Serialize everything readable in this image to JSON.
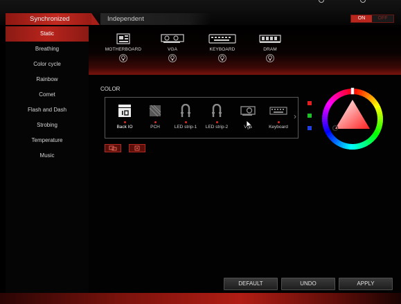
{
  "tabs": {
    "synchronized": "Synchronized",
    "independent": "Independent"
  },
  "toggle": {
    "on": "ON",
    "off": "OFF"
  },
  "sidebar": {
    "items": [
      {
        "label": "Static",
        "active": true
      },
      {
        "label": "Breathing"
      },
      {
        "label": "Color cycle"
      },
      {
        "label": "Rainbow"
      },
      {
        "label": "Comet"
      },
      {
        "label": "Flash and Dash"
      },
      {
        "label": "Strobing"
      },
      {
        "label": "Temperature"
      },
      {
        "label": "Music"
      }
    ]
  },
  "devices": [
    {
      "label": "MOTHERBOARD",
      "icon": "motherboard-icon"
    },
    {
      "label": "VGA",
      "icon": "vga-icon"
    },
    {
      "label": "KEYBOARD",
      "icon": "keyboard-icon"
    },
    {
      "label": "DRAM",
      "icon": "dram-icon"
    }
  ],
  "color_section": {
    "title": "COLOR"
  },
  "zones": [
    {
      "label": "Back IO",
      "icon": "back-io-icon"
    },
    {
      "label": "PCH",
      "icon": "pch-icon"
    },
    {
      "label": "LED strip-1",
      "icon": "led-strip-icon"
    },
    {
      "label": "LED strip-2",
      "icon": "led-strip-icon"
    },
    {
      "label": "Vga",
      "icon": "vga-card-icon"
    },
    {
      "label": "Keyboard",
      "icon": "keyboard-icon"
    }
  ],
  "swatches": [
    "#e21f1f",
    "#1fbf2a",
    "#1f3fe0"
  ],
  "colors": {
    "accent": "#b8241c",
    "selected": "#ffffff"
  },
  "buttons": {
    "default": "DEFAULT",
    "undo": "UNDO",
    "apply": "APPLY"
  }
}
